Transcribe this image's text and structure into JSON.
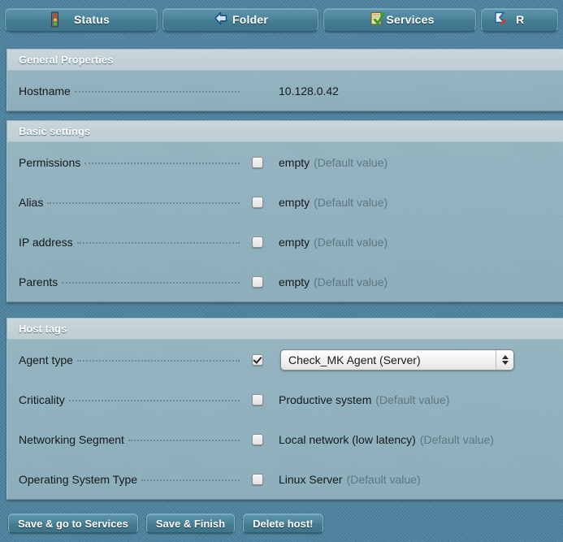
{
  "tabs": [
    {
      "label": "Status",
      "icon": "traffic-light-icon"
    },
    {
      "label": "Folder",
      "icon": "back-arrow-icon"
    },
    {
      "label": "Services",
      "icon": "clipboard-check-icon"
    },
    {
      "label": "R",
      "icon": "ruleset-flag-icon"
    }
  ],
  "sections": [
    {
      "title": "General Properties",
      "rows": [
        {
          "label": "Hostname",
          "checkbox": null,
          "value_main": "10.128.0.42",
          "value_note": ""
        }
      ]
    },
    {
      "title": "Basic settings",
      "rows": [
        {
          "label": "Permissions",
          "checkbox": false,
          "value_main": "empty",
          "value_note": "(Default value)"
        },
        {
          "label": "Alias",
          "checkbox": false,
          "value_main": "empty",
          "value_note": "(Default value)"
        },
        {
          "label": "IP address",
          "checkbox": false,
          "value_main": "empty",
          "value_note": "(Default value)"
        },
        {
          "label": "Parents",
          "checkbox": false,
          "value_main": "empty",
          "value_note": "(Default value)"
        }
      ]
    },
    {
      "title": "Host tags",
      "rows": [
        {
          "label": "Agent type",
          "checkbox": true,
          "select_value": "Check_MK Agent (Server)"
        },
        {
          "label": "Criticality",
          "checkbox": false,
          "value_main": "Productive system",
          "value_note": "(Default value)"
        },
        {
          "label": "Networking Segment",
          "checkbox": false,
          "value_main": "Local network (low latency)",
          "value_note": "(Default value)"
        },
        {
          "label": "Operating System Type",
          "checkbox": false,
          "value_main": "Linux Server",
          "value_note": "(Default value)"
        }
      ]
    }
  ],
  "buttons": [
    {
      "label": "Save & go to Services"
    },
    {
      "label": "Save & Finish"
    },
    {
      "label": "Delete host!"
    }
  ],
  "colors": {
    "page_background": "#4f87a3",
    "section_header": "#c9d7dc",
    "section_body": "#8fb2be",
    "label_text": "#15191b",
    "muted_text": "#5e7782",
    "tab_fill": "#4c8399"
  }
}
